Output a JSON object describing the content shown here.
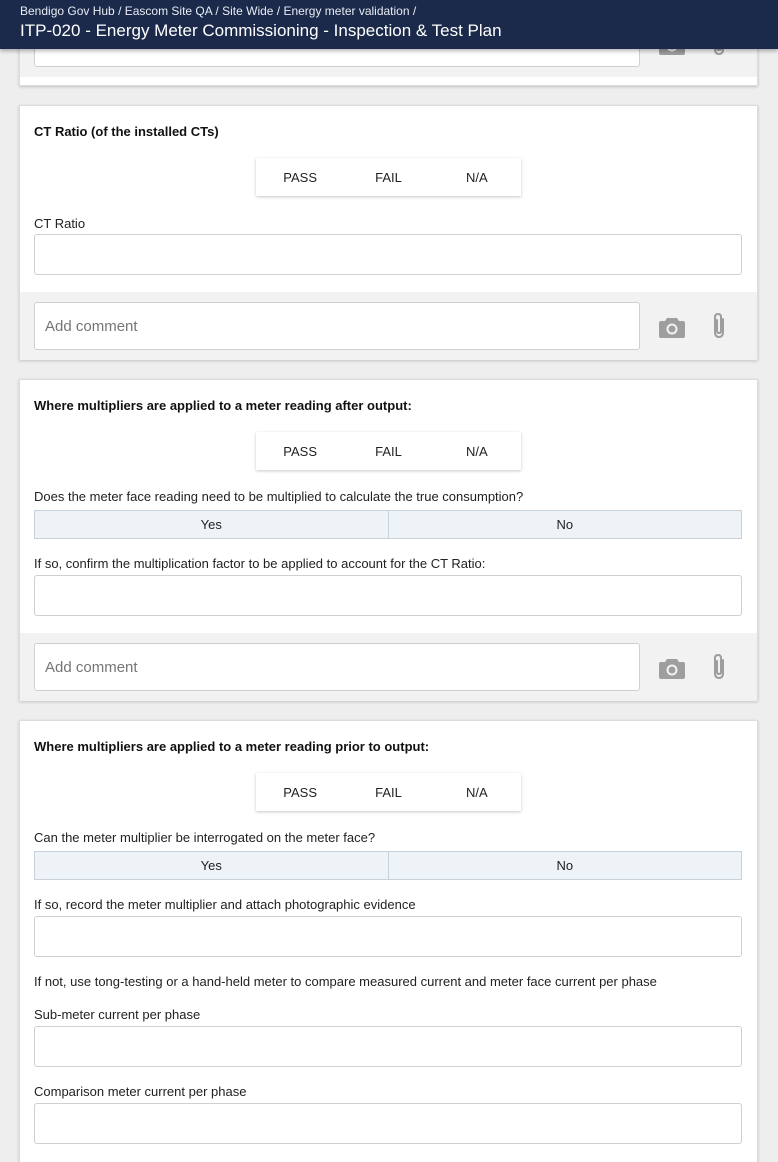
{
  "header": {
    "breadcrumb": "Bendigo Gov Hub / Eascom Site QA / Site Wide / Energy meter validation /",
    "title": "ITP-020 - Energy Meter Commissioning - Inspection & Test Plan"
  },
  "common": {
    "pass": "PASS",
    "fail": "FAIL",
    "na": "N/A",
    "yes": "Yes",
    "no": "No",
    "comment_placeholder": "Add comment"
  },
  "cards": [
    {
      "title": "CT Ratio (of the installed CTs)",
      "fields": [
        {
          "label": "CT Ratio",
          "value": ""
        }
      ]
    },
    {
      "title": "Where multipliers are applied to a meter reading after output:",
      "yesno_question": "Does the meter face reading need to be multiplied to calculate the true consumption?",
      "fields": [
        {
          "label": "If so, confirm the multiplication factor to be applied to account for the CT Ratio:",
          "value": ""
        }
      ]
    },
    {
      "title": "Where multipliers are applied to a meter reading prior to output:",
      "yesno_question": "Can the meter multiplier be interrogated on the meter face?",
      "fields": [
        {
          "label": "If so, record the meter multiplier and attach photographic evidence",
          "value": ""
        },
        {
          "label": "Sub-meter current per phase",
          "value": ""
        },
        {
          "label": "Comparison meter current per phase",
          "value": ""
        }
      ],
      "instruction": "If not, use tong-testing or a hand-held meter to compare measured current and meter face current per phase"
    }
  ],
  "icons": {
    "camera": "camera-icon",
    "attach": "paperclip-icon"
  },
  "colors": {
    "header_bg": "#1b2a4a",
    "yesno_bg": "#eef3f7",
    "icon_grey": "#9e9e9e"
  }
}
